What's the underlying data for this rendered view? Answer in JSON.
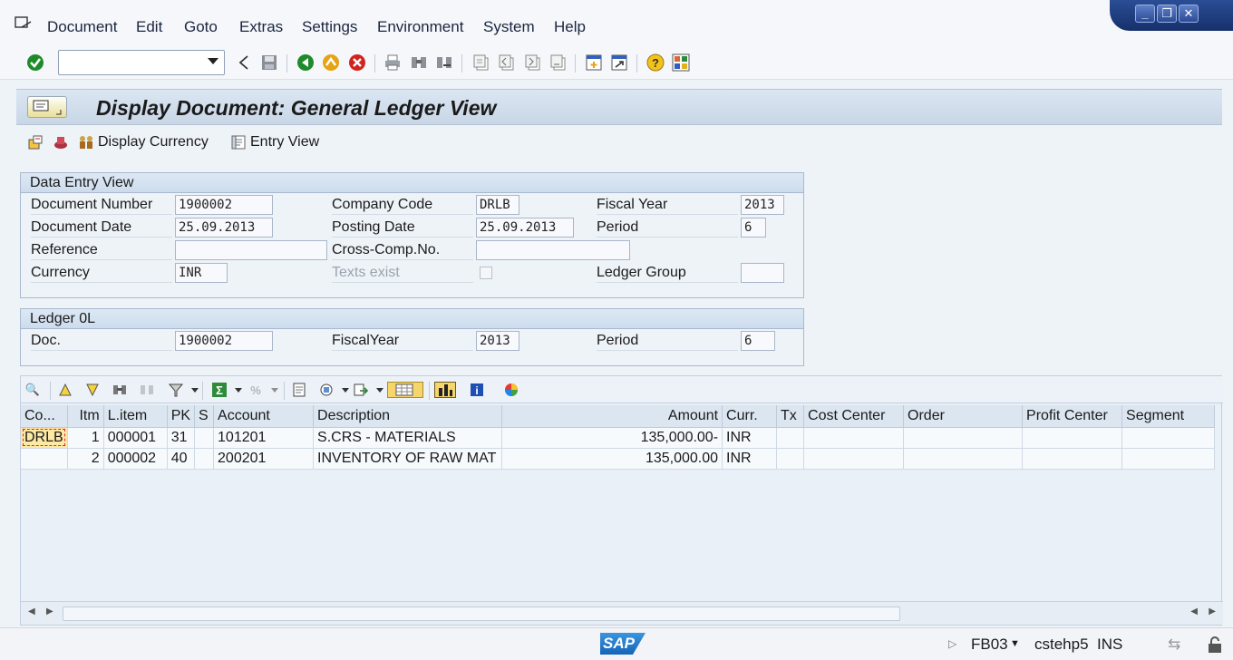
{
  "menu": {
    "items": [
      "Document",
      "Edit",
      "Goto",
      "Extras",
      "Settings",
      "Environment",
      "System",
      "Help"
    ]
  },
  "window_controls": [
    "minimize-icon",
    "restore-icon",
    "close-icon"
  ],
  "toolbar": {
    "command_field_value": "",
    "icons": [
      "enter-icon",
      "back-arrow-icon",
      "save-icon",
      "back-icon",
      "exit-icon",
      "cancel-icon",
      "print-icon",
      "find-icon",
      "find-next-icon",
      "first-page-icon",
      "previous-page-icon",
      "next-page-icon",
      "last-page-icon",
      "new-session-icon",
      "shortcut-icon",
      "help-icon",
      "customize-layout-icon"
    ]
  },
  "page": {
    "title": "Display Document: General Ledger View"
  },
  "app_toolbar": {
    "display_currency": "Display Currency",
    "entry_view": "Entry View"
  },
  "data_entry_view": {
    "heading": "Data Entry View",
    "document_number_label": "Document Number",
    "document_number": "1900002",
    "company_code_label": "Company Code",
    "company_code": "DRLB",
    "fiscal_year_label": "Fiscal Year",
    "fiscal_year": "2013",
    "document_date_label": "Document Date",
    "document_date": "25.09.2013",
    "posting_date_label": "Posting Date",
    "posting_date": "25.09.2013",
    "period_label": "Period",
    "period": "6",
    "reference_label": "Reference",
    "reference": "",
    "cross_comp_label": "Cross-Comp.No.",
    "cross_comp": "",
    "currency_label": "Currency",
    "currency": "INR",
    "texts_exist_label": "Texts exist",
    "ledger_group_label": "Ledger Group",
    "ledger_group": ""
  },
  "ledger": {
    "heading": "Ledger 0L",
    "doc_label": "Doc.",
    "doc": "1900002",
    "fiscal_year_label": "FiscalYear",
    "fiscal_year": "2013",
    "period_label": "Period",
    "period": "6"
  },
  "grid": {
    "columns": [
      "Co...",
      "Itm",
      "L.item",
      "PK",
      "S",
      "Account",
      "Description",
      "Amount",
      "Curr.",
      "Tx",
      "Cost Center",
      "Order",
      "Profit Center",
      "Segment"
    ],
    "rows": [
      {
        "co": "DRLB",
        "itm": "1",
        "litem": "000001",
        "pk": "31",
        "s": "",
        "account": "101201",
        "description": "S.CRS - MATERIALS",
        "amount": "135,000.00-",
        "curr": "INR",
        "tx": "",
        "cost_center": "",
        "order": "",
        "profit_center": "",
        "segment": ""
      },
      {
        "co": "",
        "itm": "2",
        "litem": "000002",
        "pk": "40",
        "s": "",
        "account": "200201",
        "description": "INVENTORY OF RAW MAT",
        "amount": "135,000.00",
        "curr": "INR",
        "tx": "",
        "cost_center": "",
        "order": "",
        "profit_center": "",
        "segment": ""
      }
    ]
  },
  "status": {
    "transaction": "FB03",
    "server": "cstehp5",
    "mode": "INS",
    "logo": "SAP"
  }
}
